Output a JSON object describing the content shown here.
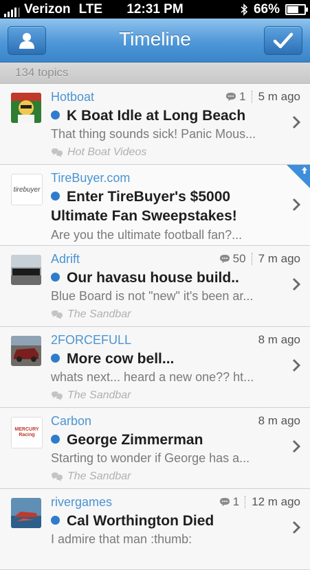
{
  "status": {
    "carrier": "Verizon",
    "network": "LTE",
    "time": "12:31 PM",
    "battery": "66%",
    "battery_level": 0.66
  },
  "nav": {
    "title": "Timeline"
  },
  "subheader": {
    "count_label": "134 topics"
  },
  "topics": [
    {
      "user": "Hotboat",
      "replies": "1",
      "time": "5 m ago",
      "title": "K Boat Idle at Long Beach",
      "preview": "That thing sounds sick! Panic Mous...",
      "forum": "Hot Boat Videos"
    },
    {
      "user": "TireBuyer.com",
      "title": "Enter TireBuyer's $5000 Ultimate Fan Sweepstakes!",
      "preview": "Are you the ultimate football fan?...",
      "avatar_text": "tirebuyer"
    },
    {
      "user": "Adrift",
      "replies": "50",
      "time": "7 m ago",
      "title": "Our havasu house build..",
      "preview": "Blue Board is not \"new\" it's been ar...",
      "forum": "The Sandbar"
    },
    {
      "user": "2FORCEFULL",
      "time": "8 m ago",
      "title": "More cow bell...",
      "preview": "whats next... heard a new one?? ht...",
      "forum": "The Sandbar"
    },
    {
      "user": "Carbon",
      "time": "8 m ago",
      "title": "George Zimmerman",
      "preview": "Starting to wonder if George has a...",
      "forum": "The Sandbar",
      "avatar_text": "MERCURY Racing"
    },
    {
      "user": "rivergames",
      "replies": "1",
      "time": "12 m ago",
      "title": "Cal Worthington Died",
      "preview": "I admire that man :thumb:"
    }
  ],
  "colors": {
    "accent": "#4a94d2",
    "navbar": "#4e97d8",
    "unread_dot": "#2f7ccc"
  }
}
